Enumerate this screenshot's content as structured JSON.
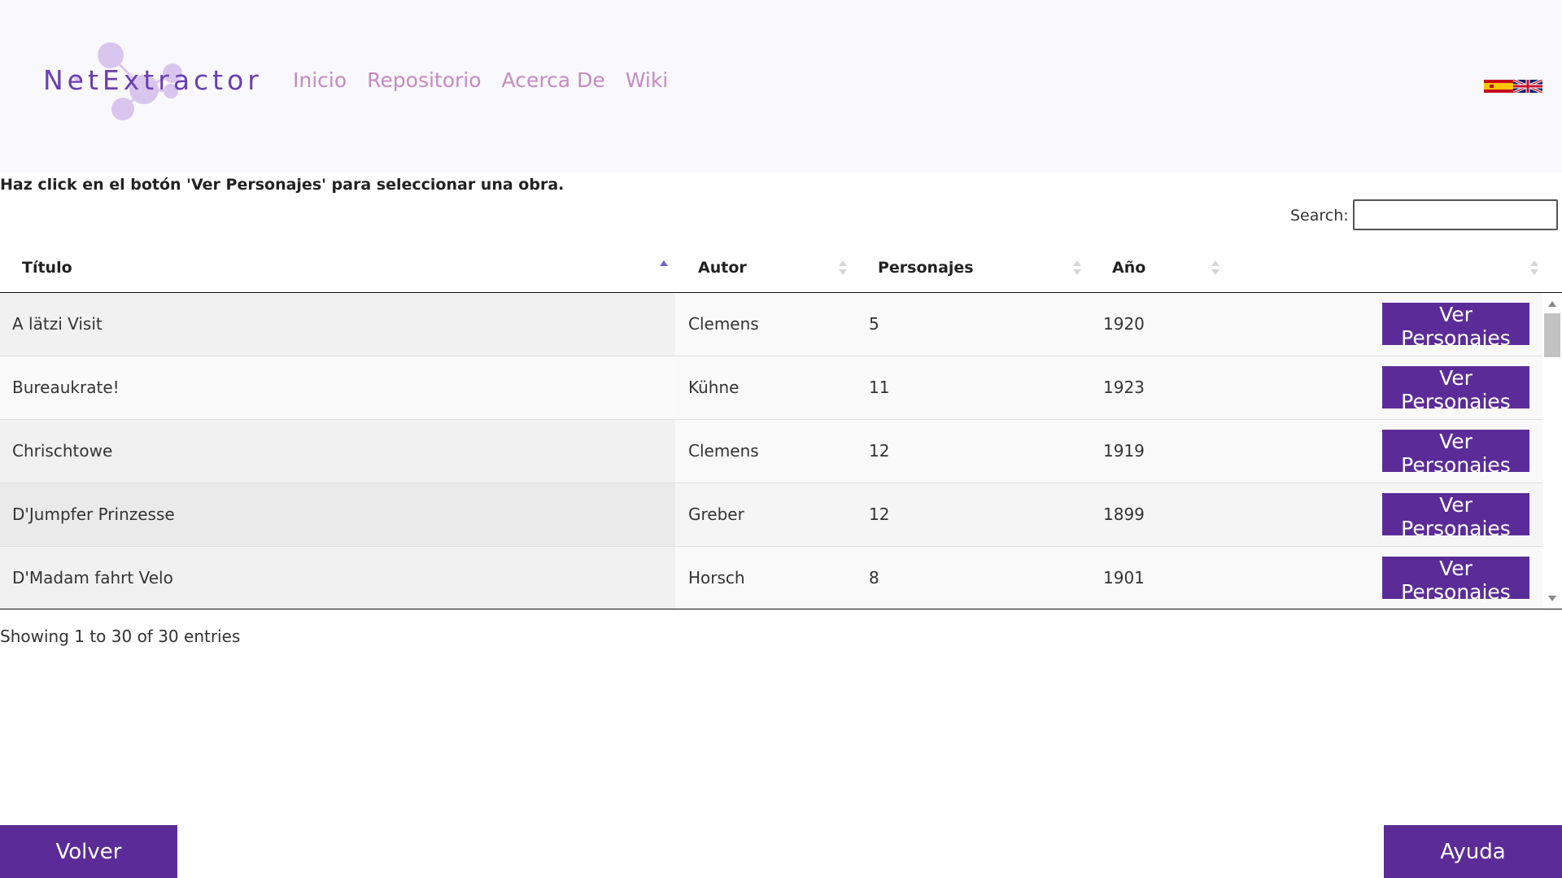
{
  "header": {
    "logo_text": "NetExtractor",
    "nav": [
      "Inicio",
      "Repositorio",
      "Acerca De",
      "Wiki"
    ],
    "languages": [
      "es-flag-icon",
      "uk-flag-icon"
    ]
  },
  "instructions": "Haz click en el botón 'Ver Personajes' para seleccionar una obra.",
  "search": {
    "label": "Search:",
    "value": ""
  },
  "table": {
    "columns": [
      "Título",
      "Autor",
      "Personajes",
      "Año",
      ""
    ],
    "sorted_column": "Título",
    "sort_direction": "ascending",
    "button_label": "Ver Personajes",
    "rows": [
      [
        "A lätzi Visit",
        "Clemens",
        "5",
        "1920"
      ],
      [
        "Bureaukrate!",
        "Kühne",
        "11",
        "1923"
      ],
      [
        "Chrischtowe",
        "Clemens",
        "12",
        "1919"
      ],
      [
        "D'Jumpfer Prinzesse",
        "Greber",
        "12",
        "1899"
      ],
      [
        "D'Madam fahrt Velo",
        "Horsch",
        "8",
        "1901"
      ]
    ]
  },
  "info": "Showing 1 to 30 of 30 entries",
  "footer": {
    "back_label": "Volver",
    "help_label": "Ayuda"
  },
  "colors": {
    "accent": "#5b2c97",
    "nav_link": "#c48bc2",
    "logo": "#6a3fb0",
    "header_bg": "#f9f8fc"
  }
}
